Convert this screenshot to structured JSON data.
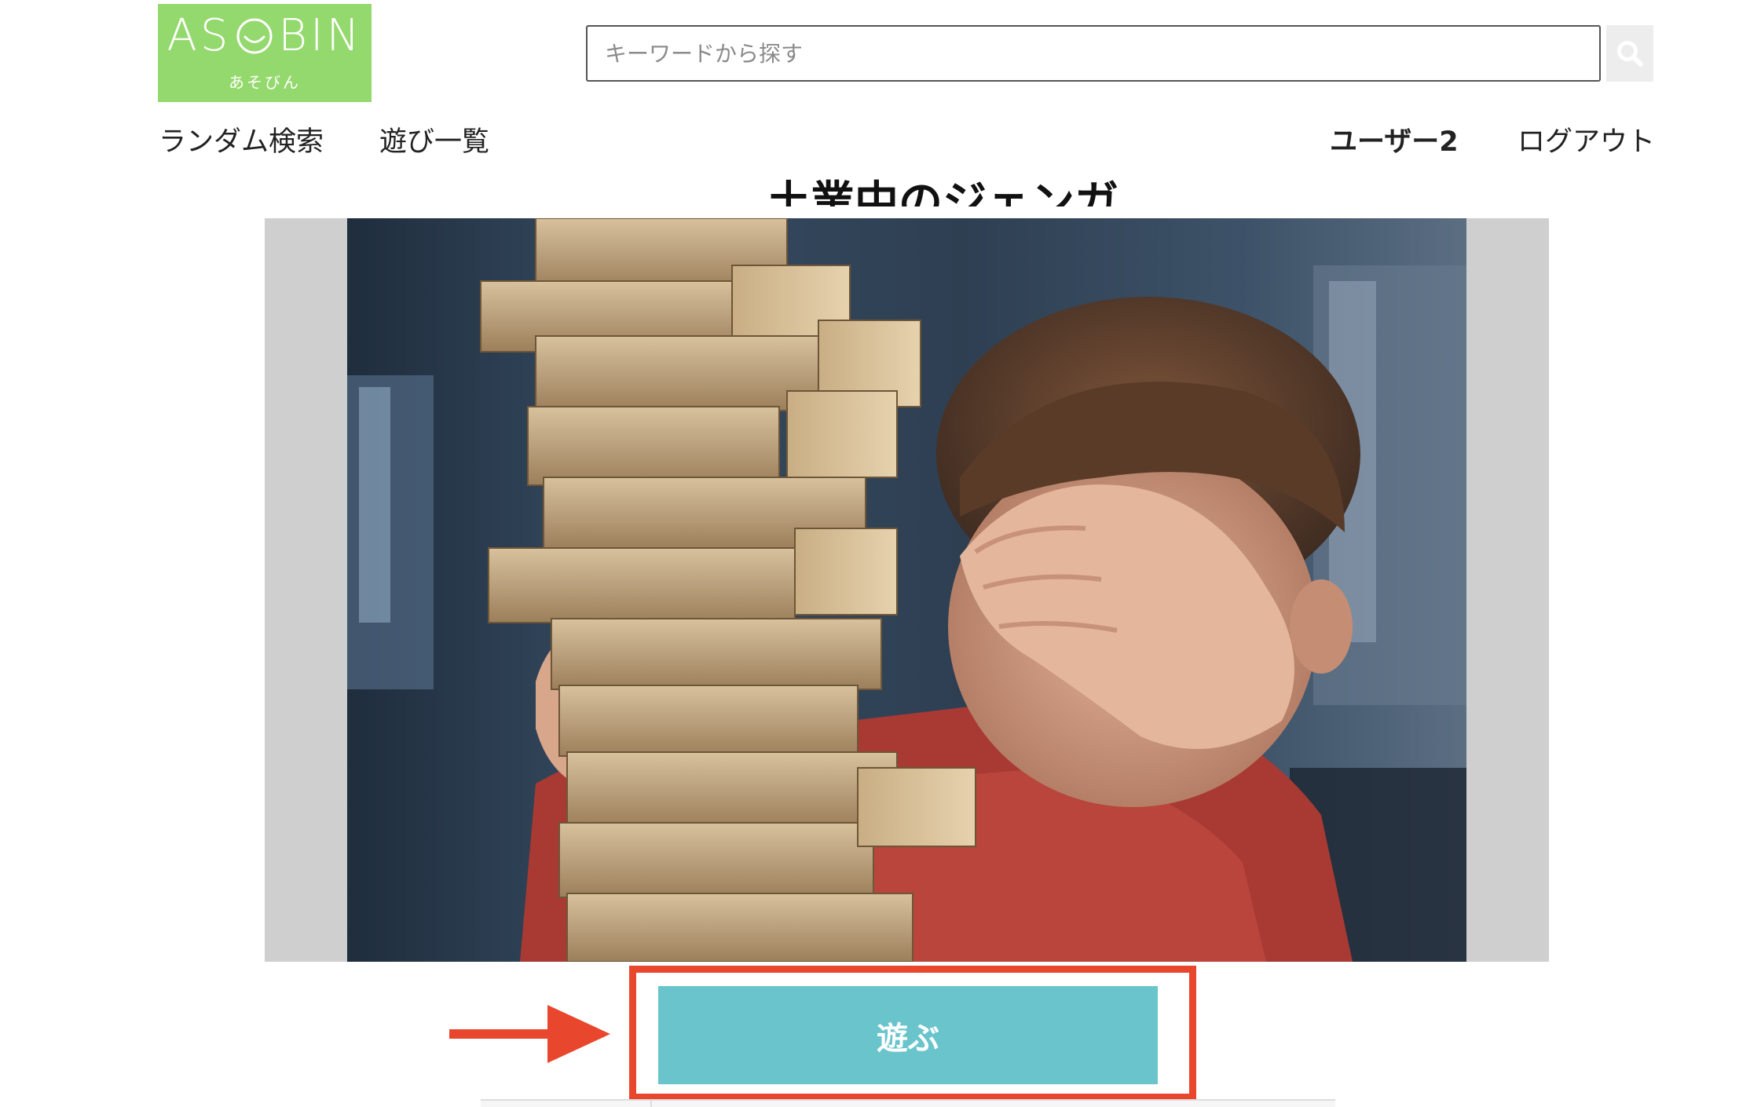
{
  "brand": {
    "logo_left": "AS",
    "logo_right": "BIN",
    "logo_sub": "あそびん",
    "color": "#94d96d"
  },
  "search": {
    "placeholder": "キーワードから探す",
    "value": "",
    "icon": "search-icon"
  },
  "nav": {
    "random_search": "ランダム検索",
    "play_list": "遊び一覧",
    "user_name": "ユーザー2",
    "logout": "ログアウト"
  },
  "content": {
    "title": "土業中のジェンガ",
    "photo_subject": "jenga-tower-photo",
    "play_button": "遊ぶ",
    "play_button_color": "#69c5cb",
    "highlight_color": "#e8472e"
  }
}
